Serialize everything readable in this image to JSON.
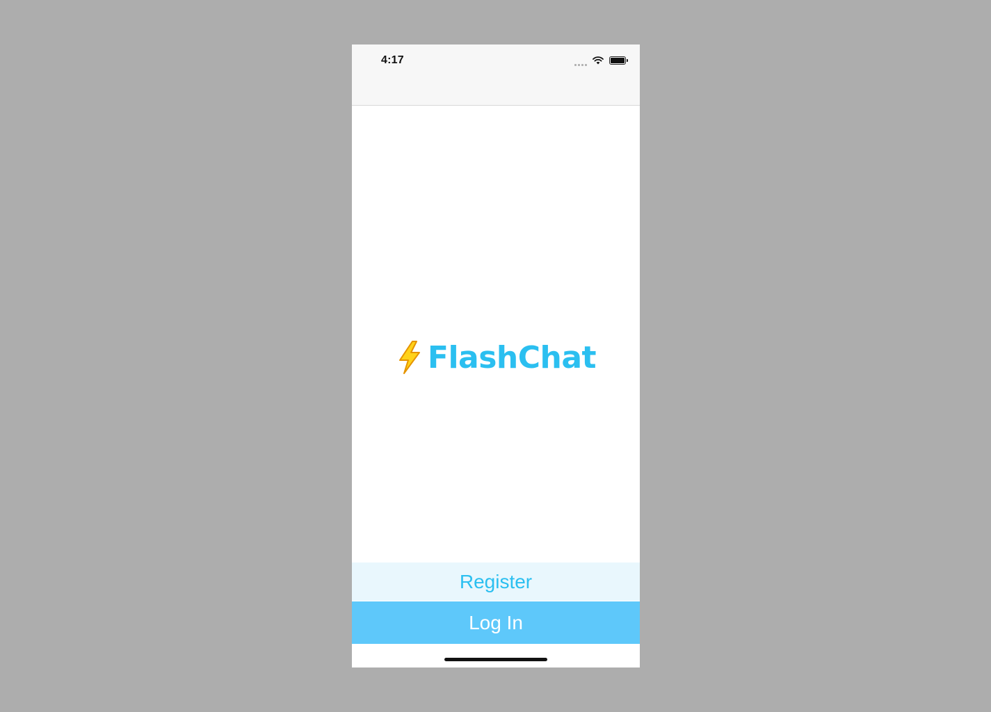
{
  "status_bar": {
    "time": "4:17",
    "icons": [
      "signal-icon",
      "wifi-icon",
      "battery-icon"
    ]
  },
  "logo": {
    "icon": "lightning-bolt-icon",
    "title": "FlashChat"
  },
  "actions": {
    "register_label": "Register",
    "login_label": "Log In"
  },
  "colors": {
    "brand": "#2bbff0",
    "register_bg": "#e9f7fd",
    "login_bg": "#5ec8fa",
    "bolt": "#f5b700"
  }
}
